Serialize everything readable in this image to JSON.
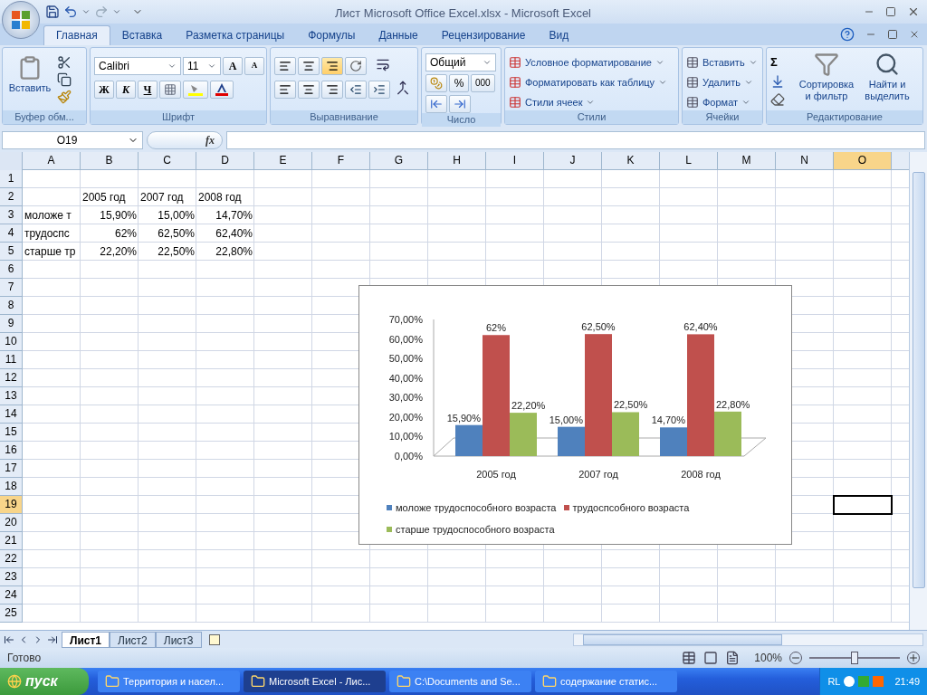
{
  "window": {
    "title": "Лист Microsoft Office Excel.xlsx - Microsoft Excel"
  },
  "ribbon_tabs": [
    {
      "label": "Главная",
      "selected": true
    },
    {
      "label": "Вставка",
      "selected": false
    },
    {
      "label": "Разметка страницы",
      "selected": false
    },
    {
      "label": "Формулы",
      "selected": false
    },
    {
      "label": "Данные",
      "selected": false
    },
    {
      "label": "Рецензирование",
      "selected": false
    },
    {
      "label": "Вид",
      "selected": false
    }
  ],
  "clipboard": {
    "paste": "Вставить",
    "label": "Буфер обм..."
  },
  "font": {
    "name": "Calibri",
    "size": "11",
    "grow": "A",
    "shrink": "A",
    "bold": "Ж",
    "italic": "К",
    "underline": "Ч",
    "label": "Шрифт"
  },
  "alignment": {
    "label": "Выравнивание"
  },
  "number": {
    "format": "Общий",
    "percent": "%",
    "thousands": "000",
    "label": "Число"
  },
  "styles": {
    "items": [
      "Условное форматирование",
      "Форматировать как таблицу",
      "Стили ячеек"
    ],
    "label": "Стили"
  },
  "cells": {
    "items": [
      "Вставить",
      "Удалить",
      "Формат"
    ],
    "label": "Ячейки"
  },
  "editing": {
    "sum": "Σ",
    "sort": [
      "Сортировка",
      "и фильтр"
    ],
    "find": [
      "Найти и",
      "выделить"
    ],
    "label": "Редактирование"
  },
  "formula_bar": {
    "name_box": "O19",
    "fx": "fx"
  },
  "columns": [
    {
      "label": "A",
      "selected": false
    },
    {
      "label": "B",
      "selected": false
    },
    {
      "label": "C",
      "selected": false
    },
    {
      "label": "D",
      "selected": false
    },
    {
      "label": "E",
      "selected": false
    },
    {
      "label": "F",
      "selected": false
    },
    {
      "label": "G",
      "selected": false
    },
    {
      "label": "H",
      "selected": false
    },
    {
      "label": "I",
      "selected": false
    },
    {
      "label": "J",
      "selected": false
    },
    {
      "label": "K",
      "selected": false
    },
    {
      "label": "L",
      "selected": false
    },
    {
      "label": "M",
      "selected": false
    },
    {
      "label": "N",
      "selected": false
    },
    {
      "label": "O",
      "selected": true
    }
  ],
  "rows": [
    {
      "label": "1",
      "selected": false
    },
    {
      "label": "2",
      "selected": false
    },
    {
      "label": "3",
      "selected": false
    },
    {
      "label": "4",
      "selected": false
    },
    {
      "label": "5",
      "selected": false
    },
    {
      "label": "6",
      "selected": false
    },
    {
      "label": "7",
      "selected": false
    },
    {
      "label": "8",
      "selected": false
    },
    {
      "label": "9",
      "selected": false
    },
    {
      "label": "10",
      "selected": false
    },
    {
      "label": "11",
      "selected": false
    },
    {
      "label": "12",
      "selected": false
    },
    {
      "label": "13",
      "selected": false
    },
    {
      "label": "14",
      "selected": false
    },
    {
      "label": "15",
      "selected": false
    },
    {
      "label": "16",
      "selected": false
    },
    {
      "label": "17",
      "selected": false
    },
    {
      "label": "18",
      "selected": false
    },
    {
      "label": "19",
      "selected": true
    },
    {
      "label": "20",
      "selected": false
    },
    {
      "label": "21",
      "selected": false
    },
    {
      "label": "22",
      "selected": false
    },
    {
      "label": "23",
      "selected": false
    },
    {
      "label": "24",
      "selected": false
    },
    {
      "label": "25",
      "selected": false
    }
  ],
  "data_rows": [
    {
      "kind": "header",
      "B": "2005 год",
      "C": "2007 год",
      "D": "2008 год"
    },
    {
      "kind": "value",
      "A": "моложе т",
      "B": "15,90%",
      "C": "15,00%",
      "D": "14,70%"
    },
    {
      "kind": "value",
      "A": "трудоспс",
      "B": "62%",
      "C": "62,50%",
      "D": "62,40%"
    },
    {
      "kind": "value",
      "A": "старше тр",
      "B": "22,20%",
      "C": "22,50%",
      "D": "22,80%"
    }
  ],
  "chart_data": {
    "type": "bar",
    "categories": [
      "2005 год",
      "2007 год",
      "2008 год"
    ],
    "ylim": [
      0,
      70
    ],
    "yticks": [
      {
        "value": 0,
        "label": "0,00%"
      },
      {
        "value": 10,
        "label": "10,00%"
      },
      {
        "value": 20,
        "label": "20,00%"
      },
      {
        "value": 30,
        "label": "30,00%"
      },
      {
        "value": 40,
        "label": "40,00%"
      },
      {
        "value": 50,
        "label": "50,00%"
      },
      {
        "value": 60,
        "label": "60,00%"
      },
      {
        "value": 70,
        "label": "70,00%"
      }
    ],
    "data_labels": true,
    "legend": true,
    "series": [
      {
        "name": "моложе трудоспособного возраста",
        "color": "#4f81bd",
        "values": [
          15.9,
          15,
          14.7
        ],
        "value_labels": [
          "15,90%",
          "15,00%",
          "14,70%"
        ]
      },
      {
        "name": "трудоспсобного возраста",
        "color": "#c0504d",
        "values": [
          62,
          62.5,
          62.4
        ],
        "value_labels": [
          "62%",
          "62,50%",
          "62,40%"
        ]
      },
      {
        "name": "старше трудоспособного возраста",
        "color": "#9bbb59",
        "values": [
          22.2,
          22.5,
          22.8
        ],
        "value_labels": [
          "22,20%",
          "22,50%",
          "22,80%"
        ]
      }
    ]
  },
  "sheet_tabs": [
    {
      "label": "Лист1",
      "selected": true
    },
    {
      "label": "Лист2",
      "selected": false
    },
    {
      "label": "Лист3",
      "selected": false
    }
  ],
  "status_bar": {
    "text": "Готово",
    "zoom": "100%",
    "zoom_slider": {
      "level": 0.5
    }
  },
  "taskbar": {
    "start": "пуск",
    "tasks": [
      {
        "label": "Территория и насел...",
        "selected": false
      },
      {
        "label": "Microsoft Excel - Лис...",
        "selected": true
      },
      {
        "label": "C:\\Documents and Se...",
        "selected": false
      },
      {
        "label": "содержание статис...",
        "selected": false
      }
    ],
    "language": "RL",
    "clock": "21:49"
  }
}
